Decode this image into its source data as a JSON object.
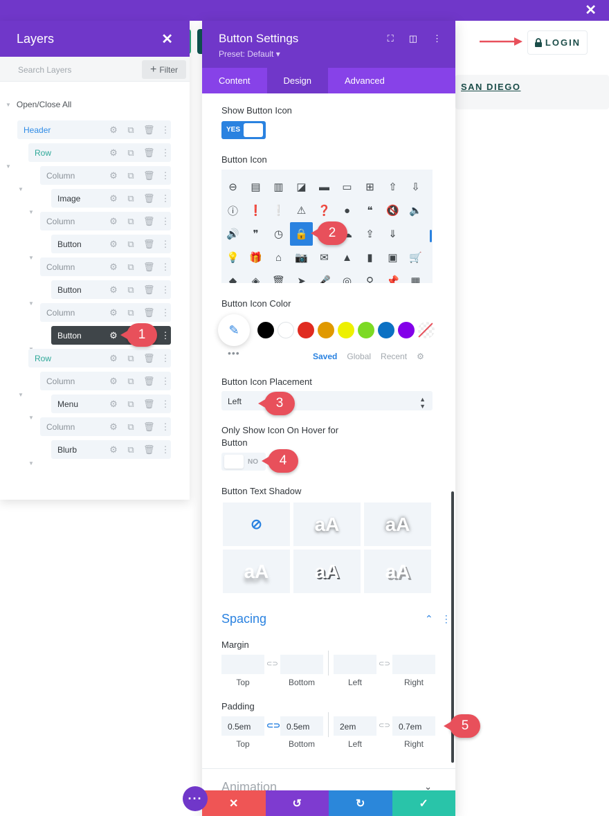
{
  "page": {
    "login_label": "LOGIN",
    "nav_item": "SAN DIEGO",
    "close_symbol": "✕"
  },
  "layers": {
    "title": "Layers",
    "close": "✕",
    "search_placeholder": "Search Layers",
    "filter_label": "Filter",
    "open_close_all": "Open/Close All",
    "items": [
      {
        "label": "Header",
        "kind": "header"
      },
      {
        "label": "Row",
        "kind": "row"
      },
      {
        "label": "Column",
        "kind": "column"
      },
      {
        "label": "Image",
        "kind": "module"
      },
      {
        "label": "Column",
        "kind": "column"
      },
      {
        "label": "Button",
        "kind": "module"
      },
      {
        "label": "Column",
        "kind": "column"
      },
      {
        "label": "Button",
        "kind": "module"
      },
      {
        "label": "Column",
        "kind": "column"
      },
      {
        "label": "Button",
        "kind": "module",
        "selected": true
      },
      {
        "label": "Row",
        "kind": "row"
      },
      {
        "label": "Column",
        "kind": "column"
      },
      {
        "label": "Menu",
        "kind": "module"
      },
      {
        "label": "Column",
        "kind": "column"
      },
      {
        "label": "Blurb",
        "kind": "module"
      }
    ]
  },
  "settings": {
    "title": "Button Settings",
    "preset": "Preset: Default ▾",
    "tabs": [
      "Content",
      "Design",
      "Advanced"
    ],
    "active_tab": "Design",
    "show_button_icon_label": "Show Button Icon",
    "show_button_icon_value": "YES",
    "button_icon_label": "Button Icon",
    "selected_icon": "lock-icon",
    "button_icon_color_label": "Button Icon Color",
    "colors": [
      "#000000",
      "#ffffff",
      "#e02b20",
      "#e09900",
      "#edf000",
      "#7cda24",
      "#0c71c3",
      "#8300e9"
    ],
    "palette_tabs": [
      "Saved",
      "Global",
      "Recent"
    ],
    "placement_label": "Button Icon Placement",
    "placement_value": "Left",
    "hover_label_line1": "Only Show Icon On Hover for",
    "hover_label_line2": "Button",
    "hover_value": "NO",
    "text_shadow_label": "Button Text Shadow",
    "shadow_sample": "aA",
    "spacing_title": "Spacing",
    "margin_label": "Margin",
    "padding_label": "Padding",
    "sides": [
      "Top",
      "Bottom",
      "Left",
      "Right"
    ],
    "margin_values": [
      "",
      "",
      "",
      ""
    ],
    "padding_values": [
      "0.5em",
      "0.5em",
      "2em",
      "0.7em"
    ],
    "animation_title": "Animation",
    "footer_buttons": [
      "cancel",
      "undo",
      "redo",
      "save"
    ],
    "footer_colors": [
      "#ef5555",
      "#7e3bd0",
      "#2b87da",
      "#29c4a9"
    ]
  },
  "badges": [
    "1",
    "2",
    "3",
    "4",
    "5"
  ]
}
